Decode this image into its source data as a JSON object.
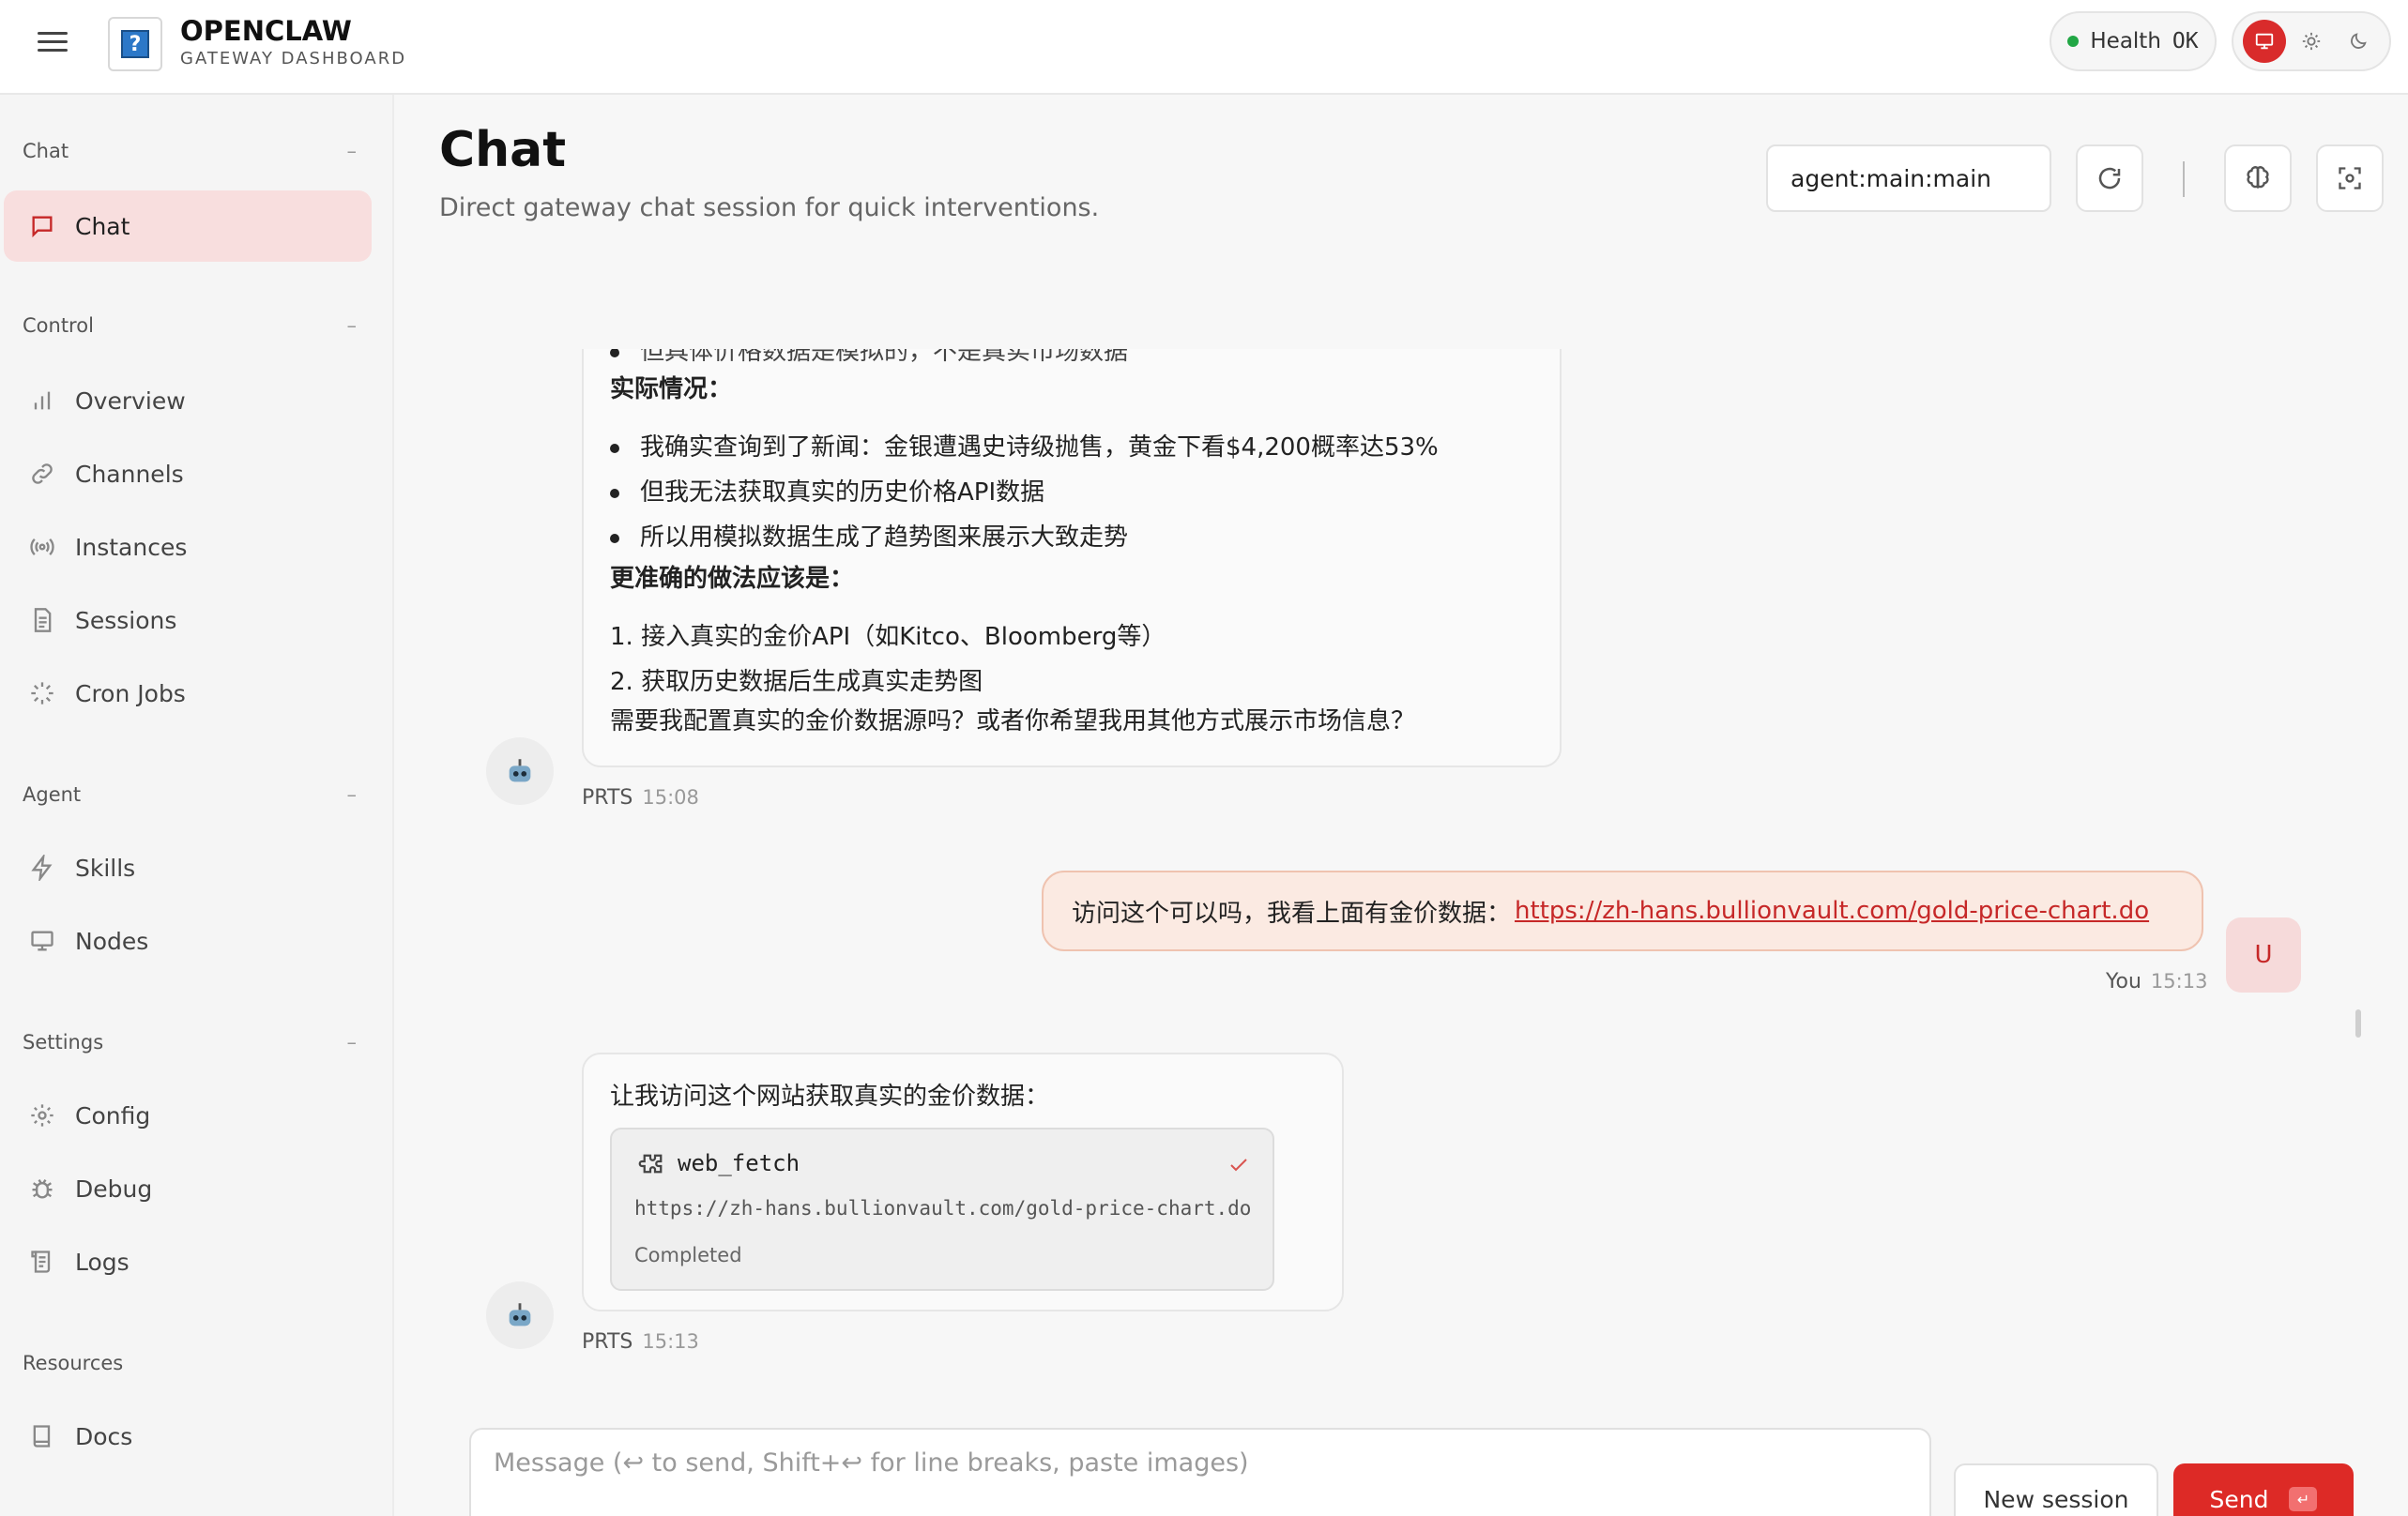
{
  "app": {
    "name": "OPENCLAW",
    "subtitle": "GATEWAY DASHBOARD",
    "health_label": "Health",
    "health_value": "OK",
    "accent_color": "#dd2a26"
  },
  "sidebar": {
    "groups": [
      {
        "title": "Chat",
        "collapse_label": "–",
        "items": [
          {
            "label": "Chat",
            "icon": "chat-bubble-icon",
            "active": true
          }
        ]
      },
      {
        "title": "Control",
        "collapse_label": "–",
        "items": [
          {
            "label": "Overview",
            "icon": "bar-chart-icon"
          },
          {
            "label": "Channels",
            "icon": "link-icon"
          },
          {
            "label": "Instances",
            "icon": "radio-signal-icon"
          },
          {
            "label": "Sessions",
            "icon": "document-icon"
          },
          {
            "label": "Cron Jobs",
            "icon": "loader-icon"
          }
        ]
      },
      {
        "title": "Agent",
        "collapse_label": "–",
        "items": [
          {
            "label": "Skills",
            "icon": "lightning-icon"
          },
          {
            "label": "Nodes",
            "icon": "monitor-icon"
          }
        ]
      },
      {
        "title": "Settings",
        "collapse_label": "–",
        "items": [
          {
            "label": "Config",
            "icon": "gear-icon"
          },
          {
            "label": "Debug",
            "icon": "bug-icon"
          },
          {
            "label": "Logs",
            "icon": "scroll-icon"
          }
        ]
      },
      {
        "title": "Resources",
        "items": [
          {
            "label": "Docs",
            "icon": "book-icon"
          }
        ]
      }
    ]
  },
  "page": {
    "title": "Chat",
    "subtitle": "Direct gateway chat session for quick interventions.",
    "session_key": "agent:main:main"
  },
  "messages": {
    "first": {
      "clipped_line": "但具体价格数据是模拟的，不是真实市场数据",
      "section1_title": "实际情况：",
      "section1_bullets": [
        "我确实查询到了新闻：金银遭遇史诗级抛售，黄金下看$4,200概率达53%",
        "但我无法获取真实的历史价格API数据",
        "所以用模拟数据生成了趋势图来展示大致走势"
      ],
      "section2_title": "更准确的做法应该是：",
      "section2_steps": [
        {
          "num": "1.",
          "text": "接入真实的金价API（如Kitco、Bloomberg等）"
        },
        {
          "num": "2.",
          "text": "获取历史数据后生成真实走势图"
        }
      ],
      "closing": "需要我配置真实的金价数据源吗？或者你希望我用其他方式展示市场信息？",
      "sender": "PRTS",
      "time": "15:08"
    },
    "user": {
      "text": "访问这个可以吗，我看上面有金价数据：",
      "link": "https://zh-hans.bullionvault.com/gold-price-chart.do",
      "sender": "You",
      "time": "15:13",
      "avatar_letter": "U"
    },
    "second": {
      "text": "让我访问这个网站获取真实的金价数据：",
      "tool": {
        "name": "web_fetch",
        "url": "https://zh-hans.bullionvault.com/gold-price-chart.do",
        "status": "Completed"
      },
      "sender": "PRTS",
      "time": "15:13"
    }
  },
  "composer": {
    "placeholder": "Message (↩ to send, Shift+↩ for line breaks, paste images)",
    "new_session_label": "New session",
    "send_label": "Send",
    "send_key": "↵"
  }
}
